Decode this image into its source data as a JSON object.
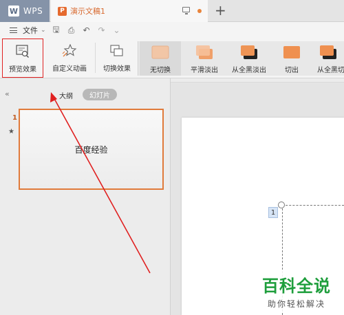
{
  "titlebar": {
    "app_name": "WPS",
    "app_logo_letter": "W",
    "document_tab": "演示文稿1",
    "doc_icon_letter": "P",
    "new_tab": "+"
  },
  "menubar": {
    "file_menu": "文件",
    "chevron": "⌄",
    "quick_access": [
      "🖫",
      "⎙",
      "↶",
      "↷",
      "⌄"
    ]
  },
  "ribbon": {
    "preview_label": "预览效果",
    "custom_anim_label": "自定义动画",
    "switch_effect_label": "切换效果",
    "transitions": [
      "无切换",
      "平滑淡出",
      "从全黑淡出",
      "切出",
      "从全黑切"
    ]
  },
  "leftpanel": {
    "collapse": "«",
    "tab_outline": "大纲",
    "tab_slides": "幻灯片",
    "slide_number": "1",
    "star": "★",
    "slide_title": "百度经验"
  },
  "canvas": {
    "placeholder_number": "1"
  },
  "watermark": {
    "big": "百科全说",
    "small": "助你轻松解决"
  },
  "colors": {
    "accent": "#e07a3a",
    "highlight_box": "#e02020",
    "watermark_green": "#1e9e3c"
  }
}
